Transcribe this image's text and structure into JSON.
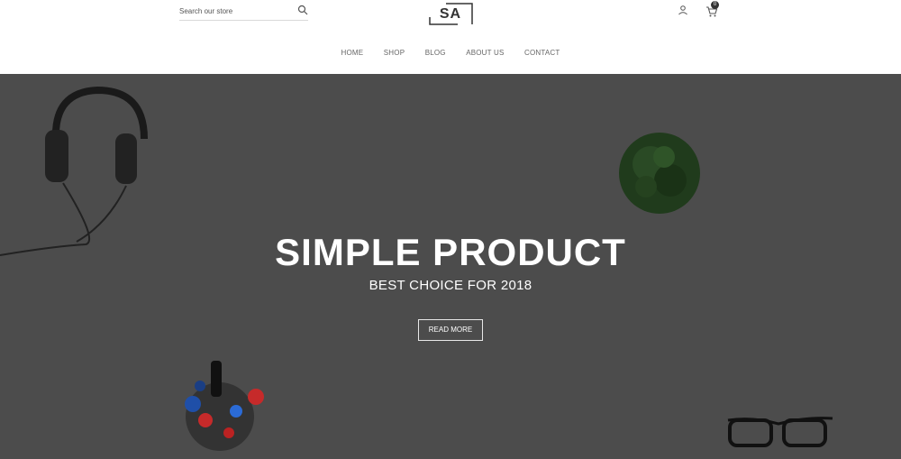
{
  "header": {
    "search": {
      "placeholder": "Search our store"
    },
    "logo": {
      "text": "SA"
    },
    "cart": {
      "count": "0"
    },
    "nav": [
      "HOME",
      "SHOP",
      "BLOG",
      "ABOUT US",
      "CONTACT"
    ]
  },
  "hero": {
    "title": "SIMPLE PRODUCT",
    "subtitle": "BEST CHOICE FOR 2018",
    "button_label": "READ MORE"
  },
  "colors": {
    "hero_bg": "#4c4c4c",
    "text_dark": "#333333",
    "nav_text": "#666666"
  }
}
